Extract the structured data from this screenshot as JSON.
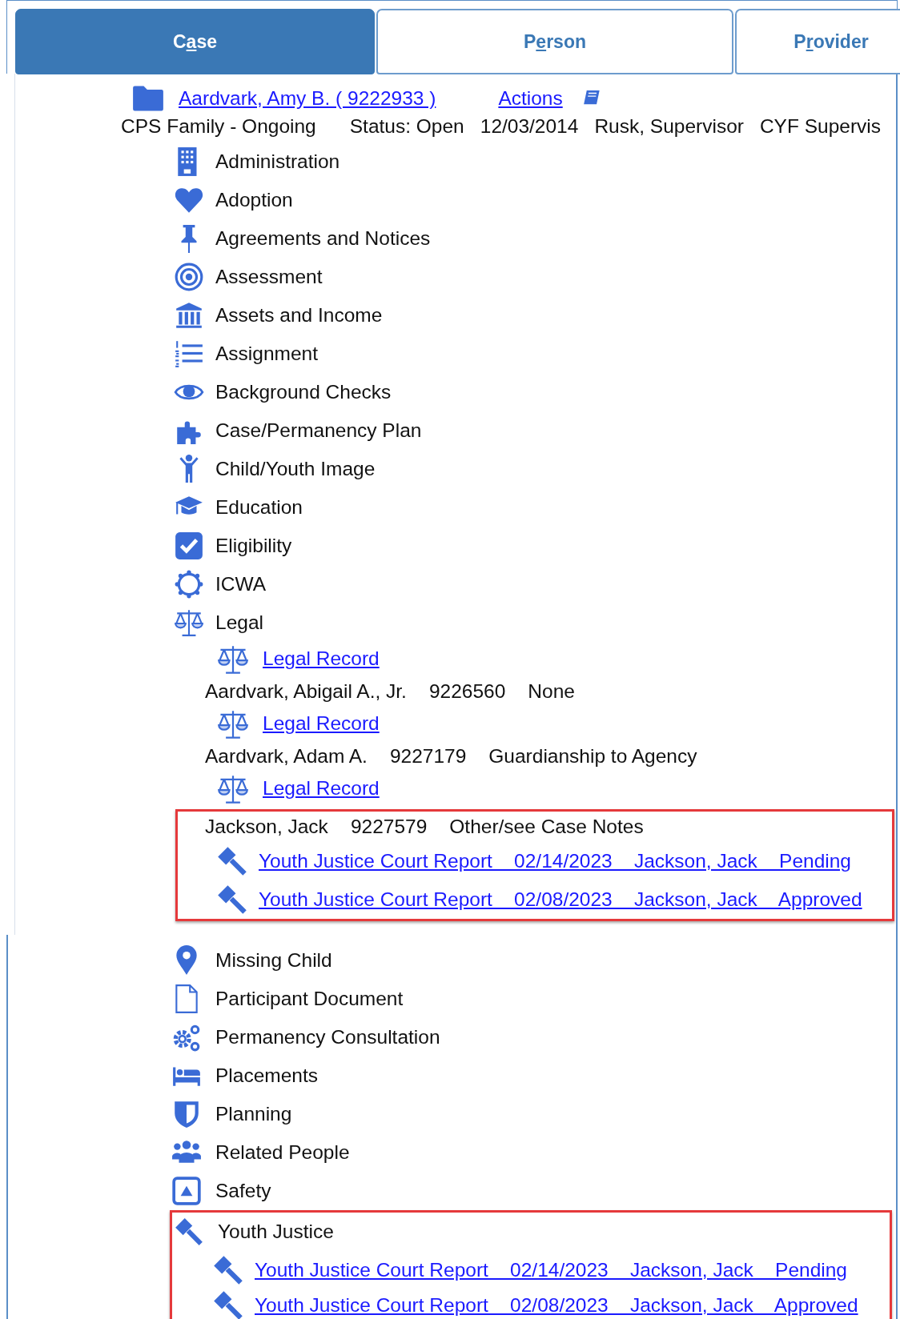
{
  "tabs": [
    {
      "label": "Case",
      "selected": true
    },
    {
      "label": "Person",
      "selected": false
    },
    {
      "label": "Provider",
      "selected": false
    }
  ],
  "case_header": {
    "name_link": "Aardvark, Amy B. ( 9222933 )",
    "actions_link": "Actions",
    "summary": [
      "CPS Family - Ongoing",
      "Status: Open",
      "12/03/2014",
      "Rusk, Supervisor",
      "CYF Supervis"
    ]
  },
  "upper_items": [
    {
      "label": "Administration"
    },
    {
      "label": "Adoption"
    },
    {
      "label": "Agreements and Notices"
    },
    {
      "label": "Assessment"
    },
    {
      "label": "Assets and Income"
    },
    {
      "label": "Assignment"
    },
    {
      "label": "Background Checks"
    },
    {
      "label": "Case/Permanency Plan"
    },
    {
      "label": "Child/Youth Image"
    },
    {
      "label": "Education"
    },
    {
      "label": "Eligibility"
    },
    {
      "label": "ICWA"
    },
    {
      "label": "Legal",
      "children": [
        {
          "kind": "record",
          "label": "Legal Record",
          "highlighted": false
        },
        {
          "kind": "party",
          "name": "Aardvark, Abigail A., Jr.",
          "id": "9226560",
          "outcome": "None",
          "highlighted": false
        },
        {
          "kind": "record",
          "label": "Legal Record",
          "highlighted": false
        },
        {
          "kind": "party",
          "name": "Aardvark, Adam A.",
          "id": "9227179",
          "outcome": "Guardianship to Agency",
          "highlighted": false
        },
        {
          "kind": "record",
          "label": "Legal Record",
          "highlighted": false
        },
        {
          "kind": "party",
          "name": "Jackson, Jack",
          "id": "9227579",
          "outcome": "Other/see Case Notes",
          "highlighted": true
        },
        {
          "kind": "report",
          "title": "Youth Justice Court Report",
          "date": "02/14/2023",
          "person": "Jackson, Jack",
          "status": "Pending",
          "highlighted": true
        },
        {
          "kind": "report",
          "title": "Youth Justice Court Report",
          "date": "02/08/2023",
          "person": "Jackson, Jack",
          "status": "Approved",
          "highlighted": true
        }
      ]
    }
  ],
  "lower_items": [
    {
      "label": "Missing Child",
      "highlighted": false
    },
    {
      "label": "Participant Document",
      "highlighted": false
    },
    {
      "label": "Permanency Consultation",
      "highlighted": false
    },
    {
      "label": "Placements",
      "highlighted": false
    },
    {
      "label": "Planning",
      "highlighted": false
    },
    {
      "label": "Related People",
      "highlighted": false
    },
    {
      "label": "Safety",
      "highlighted": false
    },
    {
      "label": "Youth Justice",
      "highlighted": true,
      "children": [
        {
          "kind": "report",
          "title": "Youth Justice Court Report",
          "date": "02/14/2023",
          "person": "Jackson, Jack",
          "status": "Pending",
          "highlighted": true
        },
        {
          "kind": "report",
          "title": "Youth Justice Court Report",
          "date": "02/08/2023",
          "person": "Jackson, Jack",
          "status": "Approved",
          "highlighted": true
        }
      ]
    }
  ]
}
